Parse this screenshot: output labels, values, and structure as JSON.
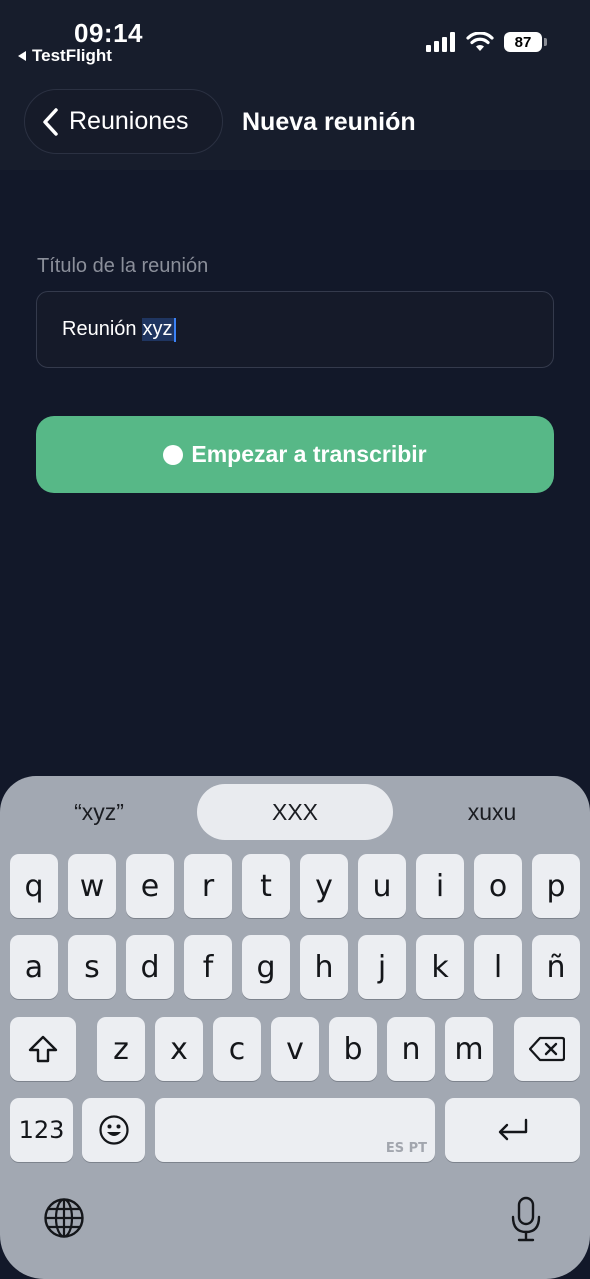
{
  "status_bar": {
    "time": "09:14",
    "back_app": "TestFlight",
    "battery": "87"
  },
  "nav": {
    "back_label": "Reuniones",
    "title": "Nueva reunión"
  },
  "form": {
    "label": "Título de la reunión",
    "value_before": "Reunión",
    "value_selected": "xyz"
  },
  "button": {
    "label": "Empezar a transcribir"
  },
  "keyboard": {
    "suggestions": [
      "“xyz”",
      "XXX",
      "xuxu"
    ],
    "row1": [
      "q",
      "w",
      "e",
      "r",
      "t",
      "y",
      "u",
      "i",
      "o",
      "p"
    ],
    "row2": [
      "a",
      "s",
      "d",
      "f",
      "g",
      "h",
      "j",
      "k",
      "l",
      "ñ"
    ],
    "row3": [
      "z",
      "x",
      "c",
      "v",
      "b",
      "n",
      "m"
    ],
    "numbers_label": "123",
    "space_label": "ES PT"
  }
}
